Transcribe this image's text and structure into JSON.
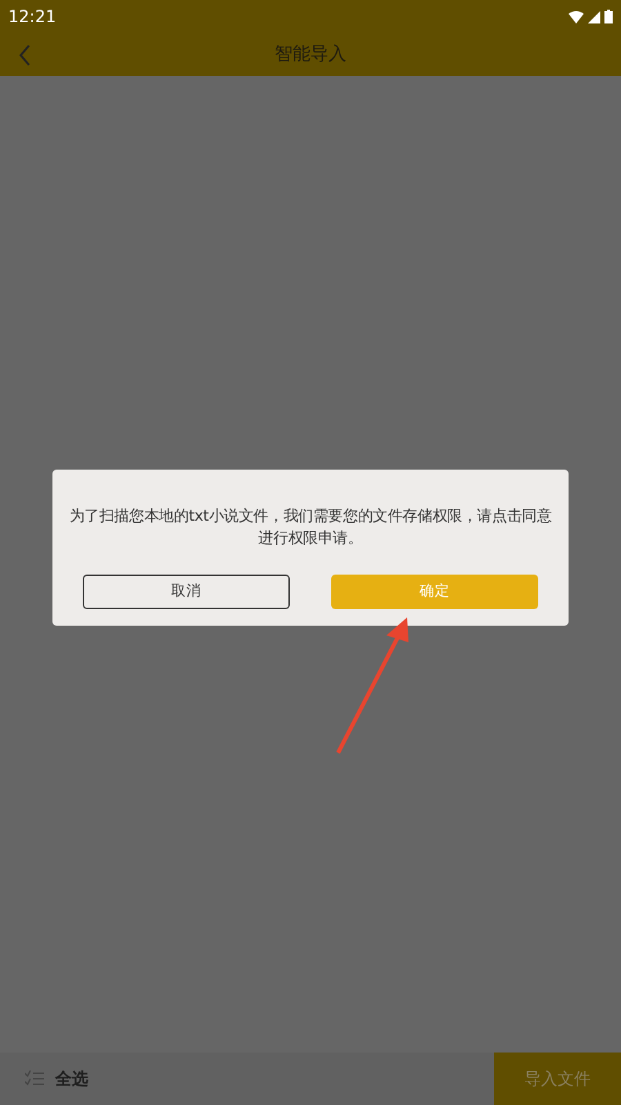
{
  "status_bar": {
    "time": "12:21"
  },
  "header": {
    "title": "智能导入"
  },
  "dialog": {
    "message": "为了扫描您本地的txt小说文件，我们需要您的文件存储权限，请点击同意进行权限申请。",
    "buttons": [
      {
        "label": "取消",
        "kind": "outline"
      },
      {
        "label": "确定",
        "kind": "filled"
      }
    ]
  },
  "annotation": {
    "kind": "arrow"
  },
  "bottom_bar": {
    "select_all": "全选",
    "import_button": "导入文件"
  }
}
